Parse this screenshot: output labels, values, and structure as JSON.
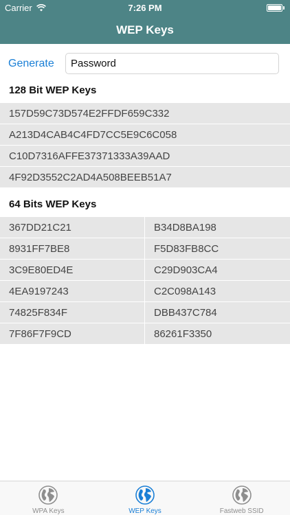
{
  "status_bar": {
    "carrier": "Carrier",
    "time": "7:26 PM"
  },
  "nav": {
    "title": "WEP Keys"
  },
  "generate": {
    "button_label": "Generate",
    "input_value": "Password"
  },
  "section_128": {
    "title": "128 Bit WEP Keys",
    "keys": [
      "157D59C73D574E2FFDF659C332",
      "A213D4CAB4C4FD7CC5E9C6C058",
      "C10D7316AFFE37371333A39AAD",
      "4F92D3552C2AD4A508BEEB51A7"
    ]
  },
  "section_64": {
    "title": "64 Bits WEP Keys",
    "keys": [
      "367DD21C21",
      "B34D8BA198",
      "8931FF7BE8",
      "F5D83FB8CC",
      "3C9E80ED4E",
      "C29D903CA4",
      "4EA9197243",
      "C2C098A143",
      "74825F834F",
      "DBB437C784",
      "7F86F7F9CD",
      "86261F3350"
    ]
  },
  "tabs": [
    {
      "label": "WPA Keys",
      "icon": "globe-icon",
      "active": false
    },
    {
      "label": "WEP Keys",
      "icon": "globe-icon",
      "active": true
    },
    {
      "label": "Fastweb SSID",
      "icon": "globe-icon",
      "active": false
    }
  ],
  "colors": {
    "header": "#4d8486",
    "accent": "#1a7fd6",
    "inactive_tab": "#8e8e8e"
  }
}
